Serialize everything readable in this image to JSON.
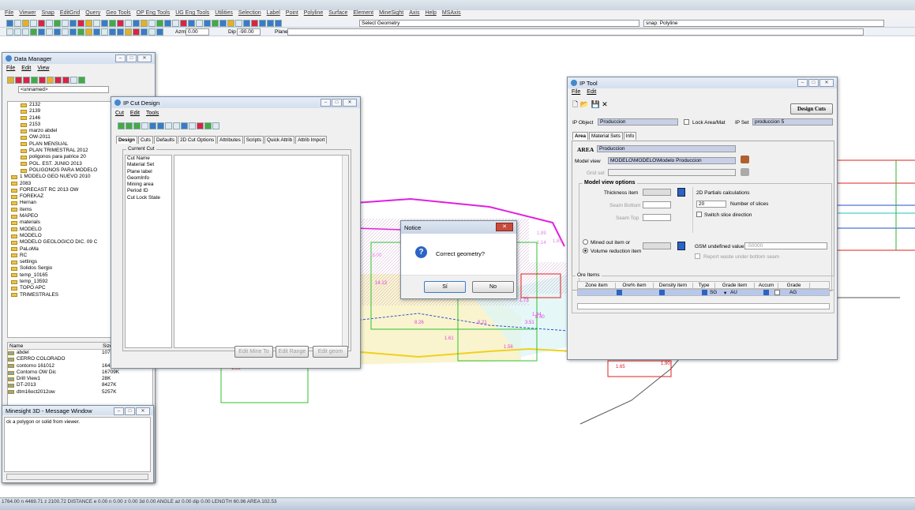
{
  "app": {
    "menu": [
      "File",
      "Viewer",
      "Snap",
      "EditGrid",
      "Query",
      "Geo Tools",
      "OP Eng Tools",
      "UG Eng Tools",
      "Utilities",
      "Selection",
      "Label",
      "Point",
      "Polyline",
      "Surface",
      "Element",
      "MineSight",
      "Axis",
      "Help",
      "MSAxis"
    ],
    "geometry_select": "Select Geometry",
    "snap": "snap: Polyline",
    "azm": "0.00",
    "dip": "-90.00",
    "azm_label": "Azm",
    "dip_label": "Dip",
    "plane_label": "Plane",
    "status": "1764.00  n 4469.71  z 2100.72  DISTANCE  e 0.00  n 0.00  z 0.00  3d 0.00   ANGLE  az 0.00  dip 0.00   LENGTH 60.96   AREA 102.53"
  },
  "data_manager": {
    "title": "Data Manager",
    "menu": [
      "File",
      "Edit",
      "View"
    ],
    "path": "<unnamed>",
    "tree": [
      "2132",
      "2139",
      "2146",
      "2153",
      "marzo abdel",
      "OW-2011",
      "PLAN MENSUAL",
      "PLAN TRIMESTRAL 2012",
      "poligonos para patrice 20",
      "POL. EST. JUNIO 2013",
      "POLIGONOS PARA MODELO",
      "1 MODELO GEO NUEVO 2010",
      "2083",
      "FORECAST RC 2013 OW",
      "FOREKAZ",
      "Hernan",
      "items",
      "MAPEO",
      "materials",
      "MODELO",
      "MODELO",
      "MODELO GEOLOGICO DIC. 09 C",
      "PaLoMa",
      "RC",
      "settings",
      "Solidos Sergio",
      "temp_10165",
      "temp_13592",
      "TOPO APC",
      "TRIMESTRALES"
    ],
    "list_headers": [
      "Name",
      "Size"
    ],
    "list": [
      {
        "name": "abdel",
        "size": "1073"
      },
      {
        "name": "CERRO COLORADO",
        "size": ""
      },
      {
        "name": "contorno 161012",
        "size": "16451K"
      },
      {
        "name": "Contorno OW Dic",
        "size": "16709K"
      },
      {
        "name": "Drill View1",
        "size": "28K"
      },
      {
        "name": "DT-2013",
        "size": "8427K"
      },
      {
        "name": "dtm16oct2012ow",
        "size": "5257K"
      }
    ]
  },
  "message_window": {
    "title": "Minesight 3D - Message Window",
    "text": "ck a polygon or solid from viewer."
  },
  "ip_cut": {
    "title": "IP Cut Design",
    "menu": [
      "Cut",
      "Edit",
      "Tools"
    ],
    "tabs": [
      "Design",
      "Cuts",
      "Defaults",
      "2D Cut Options",
      "Attributes",
      "Scripts",
      "Quick Attrib",
      "Attrib Import"
    ],
    "group": "Current Cut",
    "fields": [
      "Cut Name",
      "Material Set",
      "Plane label",
      "GeomInfo",
      "Mining area",
      "Period ID",
      "Cut Lock State"
    ],
    "buttons": [
      "Edit Mine To",
      "Edit Range",
      "Edit geom"
    ]
  },
  "ip_tool": {
    "title": "IP Tool",
    "menu": [
      "File",
      "Edit"
    ],
    "design_cuts": "Design Cuts",
    "ip_object_label": "IP Object",
    "ip_object": "Produccion",
    "lock_label": "Lock Area/Mat",
    "ip_set_label": "IP Set",
    "ip_set": "produccion 5",
    "tabs": [
      "Area",
      "Material Sets",
      "Info"
    ],
    "area_label": "AREA",
    "area_value": "Produccion",
    "model_view_label": "Model view",
    "model_view": "MODELO\\MODELO\\Modelo Produccion",
    "grid_set_label": "Grid set",
    "mvo_title": "Model view options",
    "thickness": "Thickness item",
    "seam_bottom": "Seam Bottom",
    "seam_top": "Seam Top",
    "partials": "2D Partials calculations",
    "slices": "20",
    "slices_label": "Number of slices",
    "switch_dir": "Switch slice direction",
    "mined_out": "Mined out item or",
    "volume_red": "Volume reduction item",
    "gsm_label": "GSM undefined value",
    "gsm": "-50000",
    "report_waste": "Report waste under bottom seam",
    "ore_title": "Ore Items",
    "ore_headers": [
      "Zone item",
      "Ore% item",
      "Density item",
      "Type",
      "Grade item",
      "Accum",
      "Grade"
    ],
    "ore_row": {
      "type": "SG",
      "grade": "AU",
      "accum": "AG"
    }
  },
  "notice": {
    "title": "Notice",
    "message": "Correct geometry?",
    "yes": "Sí",
    "no": "No"
  },
  "map_labels": [
    "2.87",
    "1.54",
    "3.57",
    "4.51",
    "1.50",
    "4.36",
    "1.89",
    "1.14",
    "1.85",
    "13.00",
    "1.58",
    "8.23",
    "8.26",
    "8.21",
    "1.73",
    "8.40",
    "1.56",
    "1.65",
    "1.90",
    "1.98",
    "1.94",
    "14.13",
    "1.61",
    "3.51"
  ]
}
